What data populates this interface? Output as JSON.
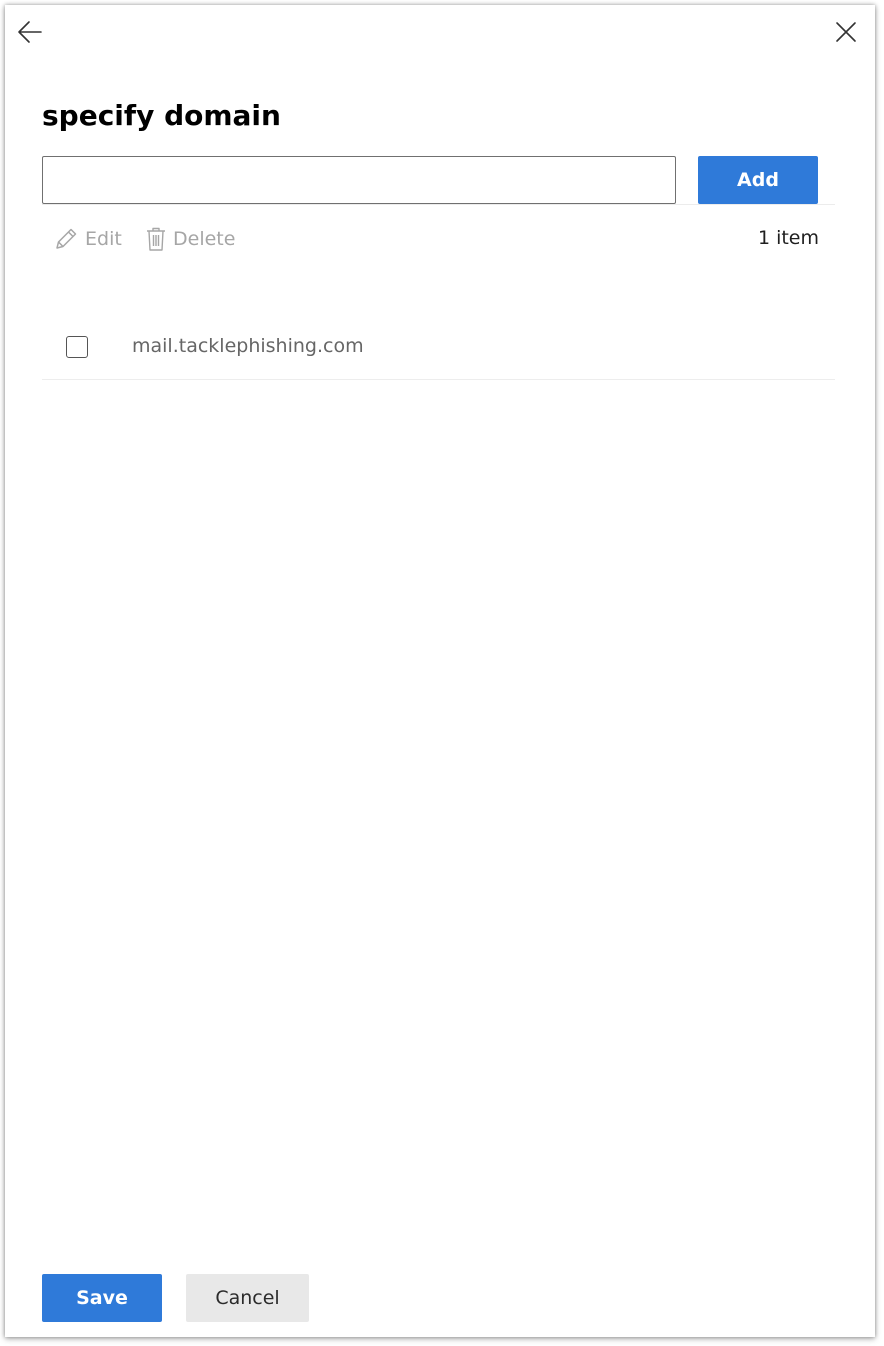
{
  "header": {
    "back_icon": "arrow-left-icon",
    "close_icon": "close-icon"
  },
  "title": "specify domain",
  "domain_input": {
    "value": "",
    "placeholder": ""
  },
  "add_label": "Add",
  "toolbar": {
    "edit_label": "Edit",
    "edit_icon": "pencil-icon",
    "delete_label": "Delete",
    "delete_icon": "trash-icon",
    "item_count": "1 item"
  },
  "items": [
    {
      "label": "mail.tacklephishing.com",
      "checked": false
    }
  ],
  "footer": {
    "save_label": "Save",
    "cancel_label": "Cancel"
  },
  "colors": {
    "primary": "#2f7ad9",
    "disabled_text": "#a6a6a6",
    "secondary_button": "#e8e8e8"
  }
}
